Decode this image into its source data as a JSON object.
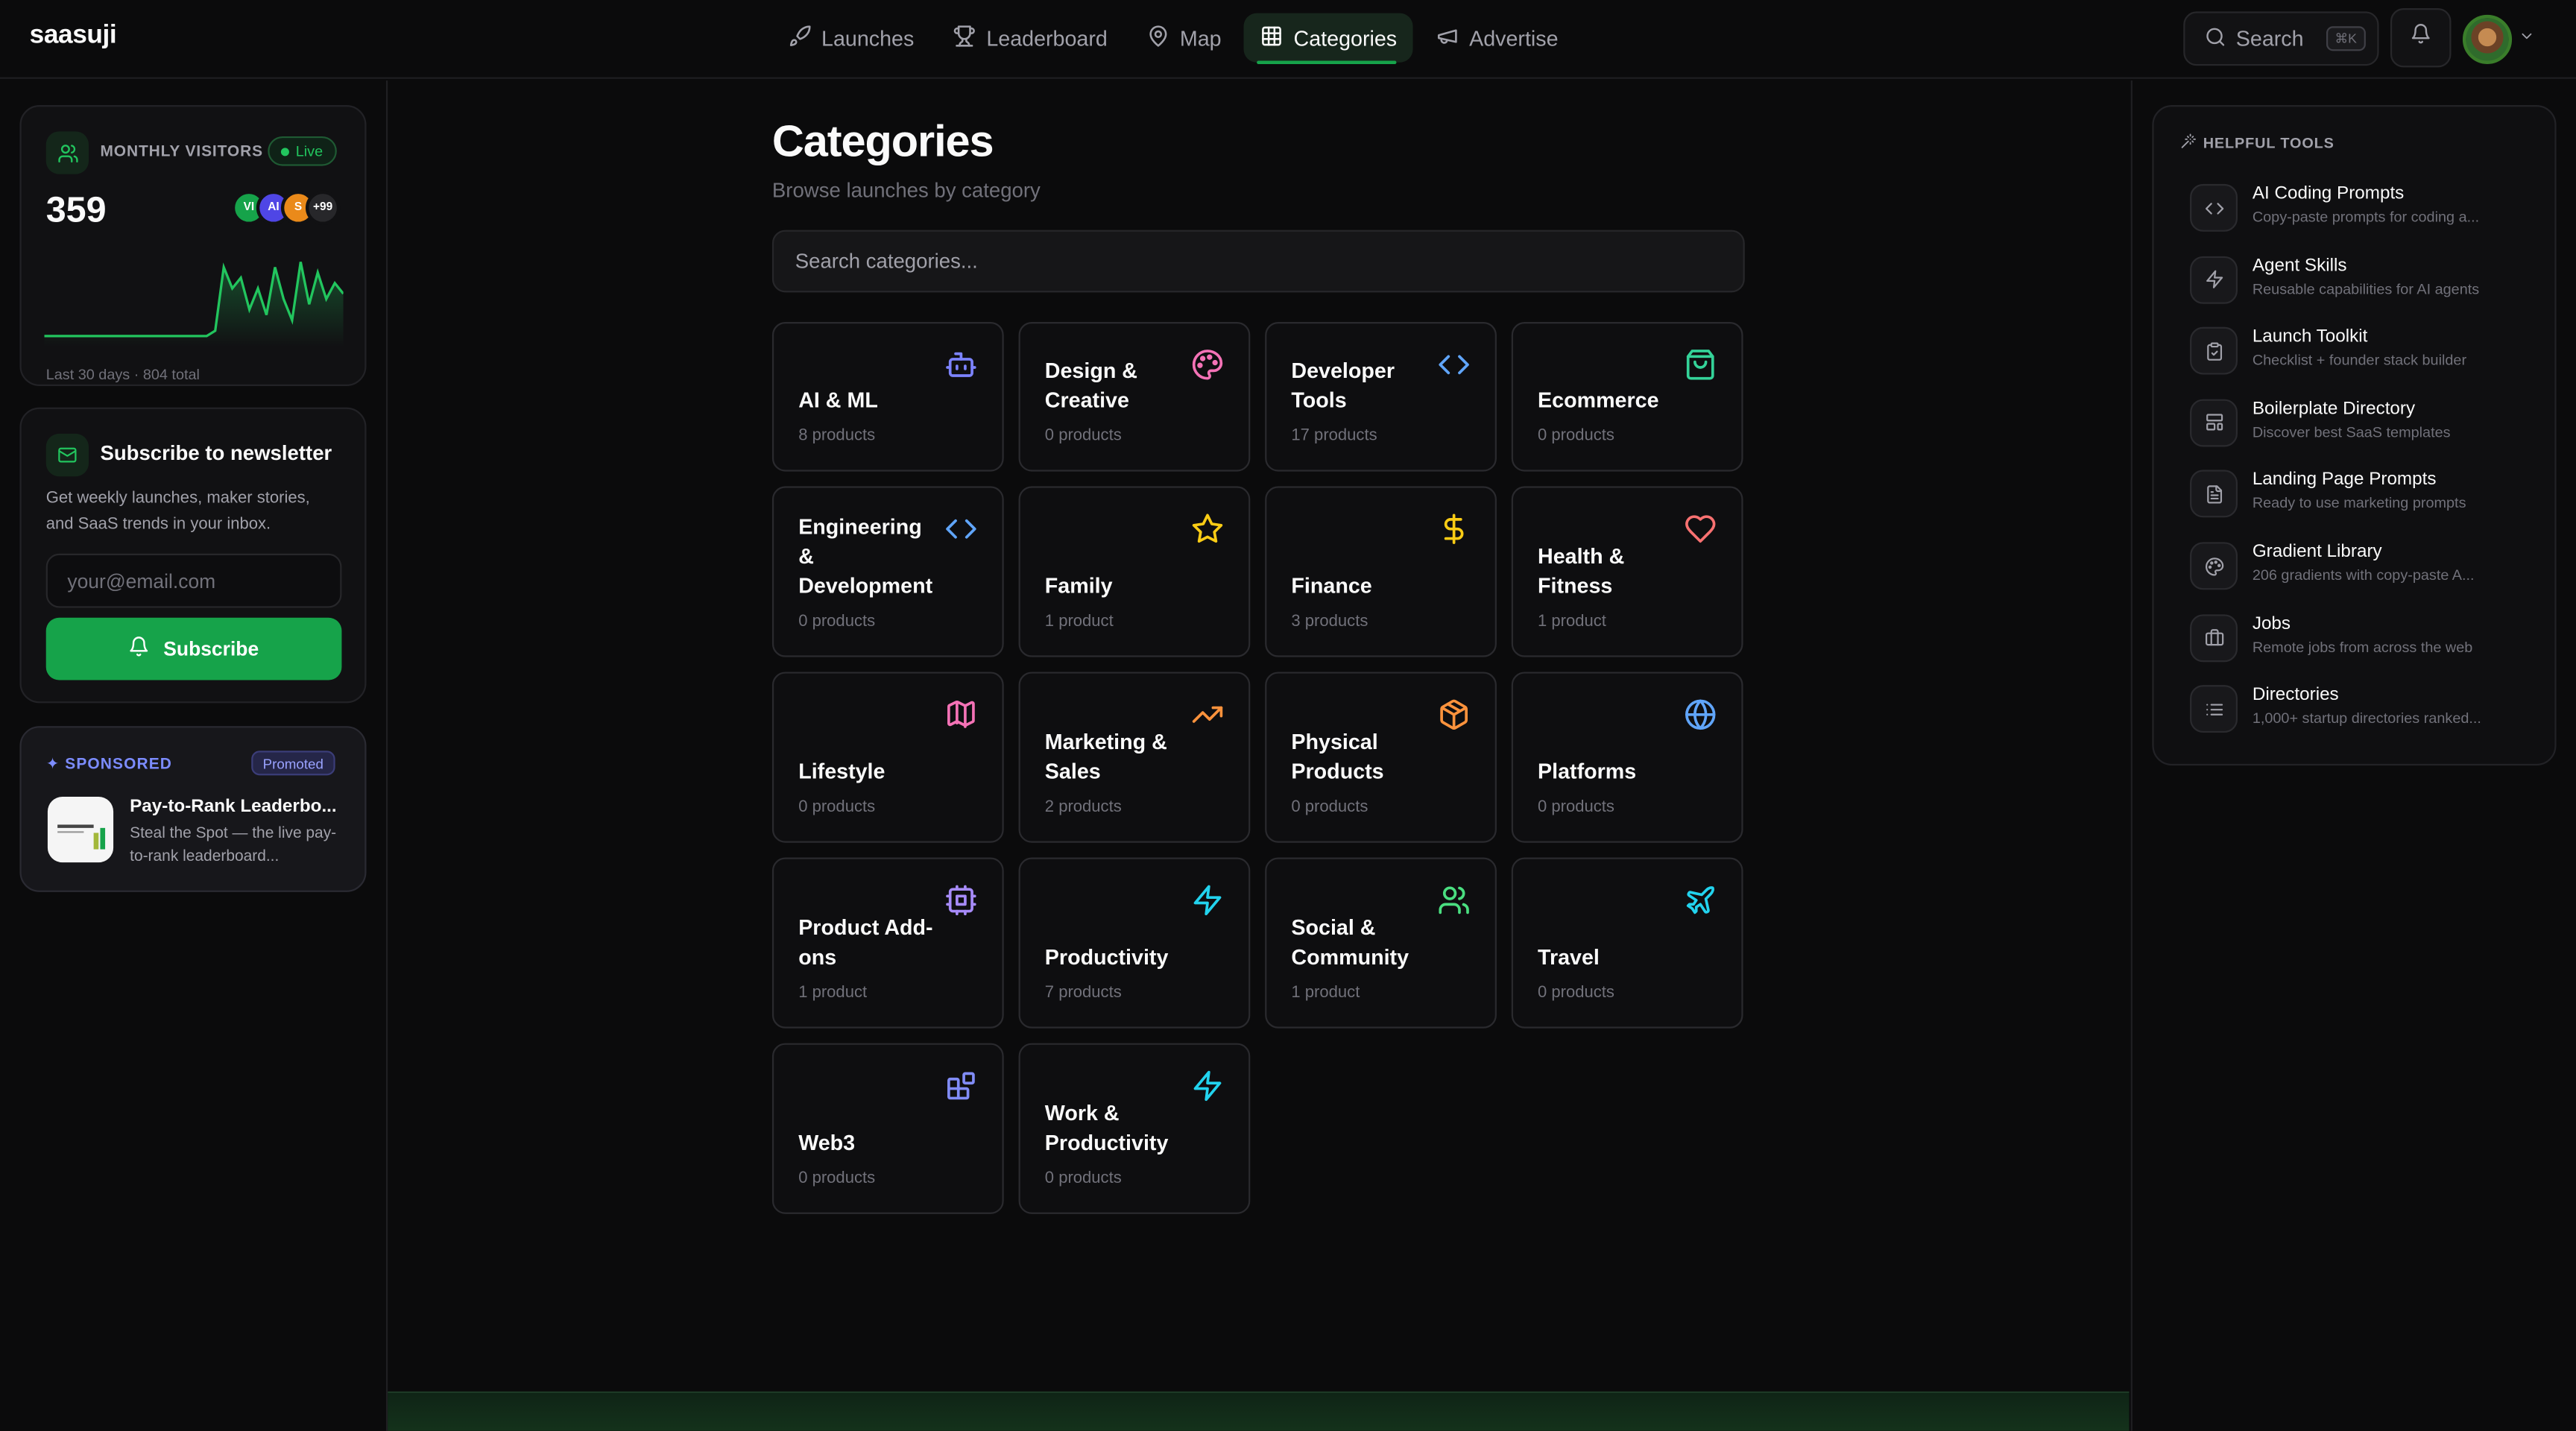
{
  "app": {
    "logo": "saasuji"
  },
  "nav": {
    "items": [
      {
        "label": "Launches",
        "icon": "rocket-icon"
      },
      {
        "label": "Leaderboard",
        "icon": "trophy-icon"
      },
      {
        "label": "Map",
        "icon": "map-pin-icon"
      },
      {
        "label": "Categories",
        "icon": "grid-icon",
        "active": true
      },
      {
        "label": "Advertise",
        "icon": "megaphone-icon"
      }
    ]
  },
  "header": {
    "search_label": "Search",
    "search_shortcut": "⌘K",
    "bell_icon": "bell-icon",
    "avatar_icon": "user-avatar"
  },
  "visitors": {
    "title": "MONTHLY VISITORS",
    "live_label": "Live",
    "count": "359",
    "avatars": [
      {
        "initials": "VI",
        "color": "#16a34a"
      },
      {
        "initials": "AI",
        "color": "#4f46e5"
      },
      {
        "initials": "S",
        "color": "#ea8a1a"
      },
      {
        "initials": "+99",
        "color": "#27272a"
      }
    ],
    "footer": "Last 30 days · 804 total",
    "accent": "#22c55e",
    "series": [
      2,
      2,
      2,
      2,
      2,
      2,
      2,
      2,
      2,
      2,
      2,
      2,
      2,
      2,
      2,
      2,
      2,
      2,
      2,
      2,
      3,
      15,
      11,
      13,
      7,
      11,
      6,
      15,
      9,
      5,
      16,
      8,
      14,
      9,
      12,
      10
    ]
  },
  "newsletter": {
    "title": "Subscribe to newsletter",
    "description": "Get weekly launches, maker stories, and SaaS trends in your inbox.",
    "email_placeholder": "your@email.com",
    "button_label": "Subscribe"
  },
  "sponsored": {
    "label": "✦ SPONSORED",
    "badge": "Promoted",
    "title": "Pay-to-Rank Leaderbo...",
    "description": "Steal the Spot — the live pay-to-rank leaderboard..."
  },
  "main": {
    "title": "Categories",
    "subtitle": "Browse launches by category",
    "search_placeholder": "Search categories..."
  },
  "categories": [
    {
      "name": "AI & ML",
      "count": "8 products",
      "icon": "bot-icon",
      "color": "#7c83ff"
    },
    {
      "name": "Design & Creative",
      "count": "0 products",
      "icon": "palette-icon",
      "color": "#f472b6"
    },
    {
      "name": "Developer Tools",
      "count": "17 products",
      "icon": "code-icon",
      "color": "#60a5fa"
    },
    {
      "name": "Ecommerce",
      "count": "0 products",
      "icon": "shopping-bag-icon",
      "color": "#34d399"
    },
    {
      "name": "Engineering & Development",
      "count": "0 products",
      "icon": "code-icon",
      "color": "#60a5fa"
    },
    {
      "name": "Family",
      "count": "1 product",
      "icon": "star-icon",
      "color": "#facc15"
    },
    {
      "name": "Finance",
      "count": "3 products",
      "icon": "dollar-icon",
      "color": "#facc15"
    },
    {
      "name": "Health & Fitness",
      "count": "1 product",
      "icon": "heart-icon",
      "color": "#f87171"
    },
    {
      "name": "Lifestyle",
      "count": "0 products",
      "icon": "map-icon",
      "color": "#f472b6"
    },
    {
      "name": "Marketing & Sales",
      "count": "2 products",
      "icon": "trending-up-icon",
      "color": "#fb923c"
    },
    {
      "name": "Physical Products",
      "count": "0 products",
      "icon": "package-icon",
      "color": "#fb923c"
    },
    {
      "name": "Platforms",
      "count": "0 products",
      "icon": "globe-icon",
      "color": "#60a5fa"
    },
    {
      "name": "Product Add-ons",
      "count": "1 product",
      "icon": "cpu-icon",
      "color": "#a78bfa"
    },
    {
      "name": "Productivity",
      "count": "7 products",
      "icon": "zap-icon",
      "color": "#22d3ee"
    },
    {
      "name": "Social & Community",
      "count": "1 product",
      "icon": "users-icon",
      "color": "#4ade80"
    },
    {
      "name": "Travel",
      "count": "0 products",
      "icon": "plane-icon",
      "color": "#22d3ee"
    },
    {
      "name": "Web3",
      "count": "0 products",
      "icon": "blocks-icon",
      "color": "#818cf8"
    },
    {
      "name": "Work & Productivity",
      "count": "0 products",
      "icon": "zap-icon",
      "color": "#22d3ee"
    }
  ],
  "tools": {
    "heading": "HELPFUL TOOLS",
    "items": [
      {
        "name": "AI Coding Prompts",
        "description": "Copy-paste prompts for coding a...",
        "icon": "code-icon"
      },
      {
        "name": "Agent Skills",
        "description": "Reusable capabilities for AI agents",
        "icon": "zap-icon"
      },
      {
        "name": "Launch Toolkit",
        "description": "Checklist + founder stack builder",
        "icon": "clipboard-check-icon"
      },
      {
        "name": "Boilerplate Directory",
        "description": "Discover best SaaS templates",
        "icon": "layout-template-icon"
      },
      {
        "name": "Landing Page Prompts",
        "description": "Ready to use marketing prompts",
        "icon": "file-text-icon"
      },
      {
        "name": "Gradient Library",
        "description": "206 gradients with copy-paste A...",
        "icon": "palette-icon"
      },
      {
        "name": "Jobs",
        "description": "Remote jobs from across the web",
        "icon": "briefcase-icon"
      },
      {
        "name": "Directories",
        "description": "1,000+ startup directories ranked...",
        "icon": "list-icon"
      }
    ]
  }
}
